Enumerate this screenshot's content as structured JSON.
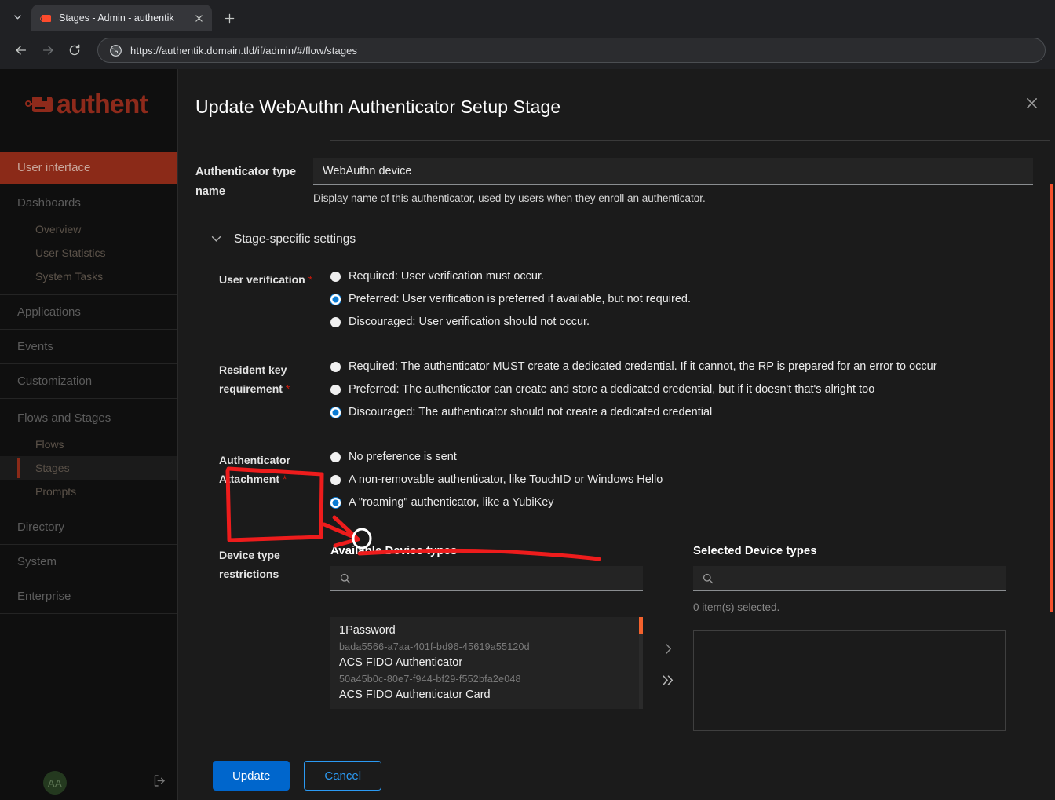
{
  "browser": {
    "tab_list_icon": "chevron-down-icon",
    "tab": {
      "title": "Stages - Admin - authentik",
      "favicon": "authentik-favicon",
      "close_icon": "close-icon"
    },
    "new_tab_icon": "plus-icon",
    "back_icon": "arrow-left-icon",
    "forward_icon": "arrow-right-icon",
    "reload_icon": "reload-icon",
    "site_icon": "globe-icon",
    "url": "https://authentik.domain.tld/if/admin/#/flow/stages"
  },
  "sidebar": {
    "brand": "authent",
    "active_banner": "User interface",
    "groups": [
      {
        "label": "Dashboards",
        "items": [
          "Overview",
          "User Statistics",
          "System Tasks"
        ]
      }
    ],
    "top_items": [
      "Applications",
      "Events",
      "Customization"
    ],
    "flows_group": {
      "label": "Flows and Stages",
      "items": [
        "Flows",
        "Stages",
        "Prompts"
      ],
      "selected": "Stages"
    },
    "bottom_items": [
      "Directory",
      "System",
      "Enterprise"
    ],
    "footer": {
      "avatar_initials": "AA",
      "logout_icon": "logout-icon"
    }
  },
  "modal": {
    "title": "Update WebAuthn Authenticator Setup Stage",
    "close_icon": "close-icon",
    "authenticator_type_name": {
      "label": "Authenticator type name",
      "value": "WebAuthn device",
      "placeholder": "",
      "help": "Display name of this authenticator, used by users when they enroll an authenticator."
    },
    "accordion": {
      "label": "Stage-specific settings",
      "chevron_icon": "chevron-down-icon",
      "expanded": true
    },
    "user_verification": {
      "label": "User verification",
      "required_star": "*",
      "options": [
        {
          "text": "Required: User verification must occur.",
          "checked": false
        },
        {
          "text": "Preferred: User verification is preferred if available, but not required.",
          "checked": true
        },
        {
          "text": "Discouraged: User verification should not occur.",
          "checked": false
        }
      ]
    },
    "resident_key_requirement": {
      "label": "Resident key requirement",
      "required_star": "*",
      "options": [
        {
          "text": "Required: The authenticator MUST create a dedicated credential. If it cannot, the RP is prepared for an error to occur",
          "checked": false
        },
        {
          "text": "Preferred: The authenticator can create and store a dedicated credential, but if it doesn't that's alright too",
          "checked": false
        },
        {
          "text": "Discouraged: The authenticator should not create a dedicated credential",
          "checked": true
        }
      ]
    },
    "authenticator_attachment": {
      "label": "Authenticator Attachment",
      "required_star": "*",
      "options": [
        {
          "text": "No preference is sent",
          "checked": false
        },
        {
          "text": "A non-removable authenticator, like TouchID or Windows Hello",
          "checked": false
        },
        {
          "text": "A \"roaming\" authenticator, like a YubiKey",
          "checked": true
        }
      ]
    },
    "device_type_restrictions": {
      "label": "Device type restrictions",
      "available": {
        "title": "Available Device types",
        "search_placeholder": "",
        "search_value": "",
        "search_icon": "search-icon",
        "items": [
          {
            "name": "1Password",
            "uid": "bada5566-a7aa-401f-bd96-45619a55120d"
          },
          {
            "name": "ACS FIDO Authenticator",
            "uid": "50a45b0c-80e7-f944-bf29-f552bfa2e048"
          },
          {
            "name": "ACS FIDO Authenticator Card",
            "uid": ""
          }
        ]
      },
      "controls": {
        "move_one_icon": "chevron-right-icon",
        "move_all_icon": "chevron-double-right-icon"
      },
      "selected": {
        "title": "Selected Device types",
        "search_placeholder": "",
        "search_value": "",
        "search_icon": "search-icon",
        "count_text": "0 item(s) selected.",
        "items": []
      }
    },
    "buttons": {
      "update": "Update",
      "cancel": "Cancel"
    }
  },
  "colors": {
    "brand_red": "#8b2a18",
    "accent_blue": "#0066cc",
    "link_blue": "#2b9af3",
    "scrollbar_orange": "#f4522d",
    "annotation_red": "#ee1c1c",
    "required_star": "#c9190b"
  }
}
